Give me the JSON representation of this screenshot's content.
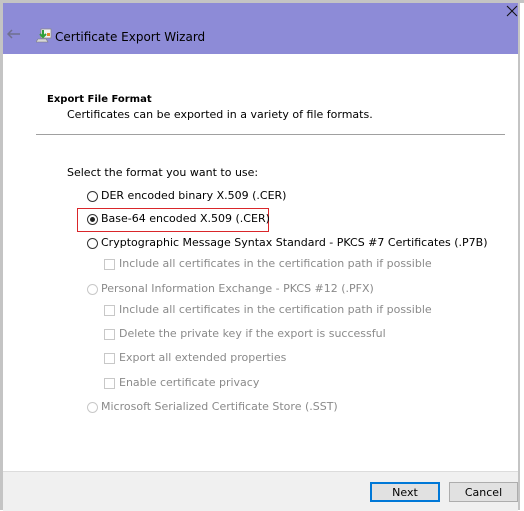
{
  "window": {
    "title": "Certificate Export Wizard",
    "titlebar_color": "#8d8bd7",
    "icons": {
      "back": "back-arrow-icon",
      "app": "certificate-wizard-icon",
      "close": "close-icon"
    }
  },
  "header": {
    "section_title": "Export File Format",
    "section_description": "Certificates can be exported in a variety of file formats."
  },
  "body": {
    "prompt": "Select the format you want to use:",
    "highlight_color": "#d9262a",
    "formats": [
      {
        "label": "DER encoded binary X.509 (.CER)",
        "selected": false,
        "enabled": true
      },
      {
        "label": "Base-64 encoded X.509 (.CER)",
        "selected": true,
        "enabled": true,
        "highlighted": true
      },
      {
        "label": "Cryptographic Message Syntax Standard - PKCS #7 Certificates (.P7B)",
        "selected": false,
        "enabled": true,
        "options": [
          {
            "label": "Include all certificates in the certification path if possible",
            "checked": false,
            "enabled": false
          }
        ]
      },
      {
        "label": "Personal Information Exchange - PKCS #12 (.PFX)",
        "selected": false,
        "enabled": false,
        "options": [
          {
            "label": "Include all certificates in the certification path if possible",
            "checked": false,
            "enabled": false
          },
          {
            "label": "Delete the private key if the export is successful",
            "checked": false,
            "enabled": false
          },
          {
            "label": "Export all extended properties",
            "checked": false,
            "enabled": false
          },
          {
            "label": "Enable certificate privacy",
            "checked": false,
            "enabled": false
          }
        ]
      },
      {
        "label": "Microsoft Serialized Certificate Store (.SST)",
        "selected": false,
        "enabled": false
      }
    ]
  },
  "footer": {
    "next_label": "Next",
    "cancel_label": "Cancel",
    "default_button_color": "#0078d7"
  }
}
